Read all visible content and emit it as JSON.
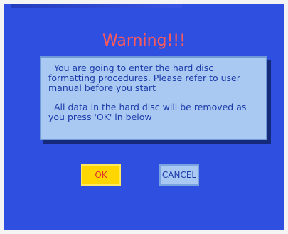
{
  "title": "Warning!!!",
  "message": {
    "line1": "You are going to enter the hard disc formatting procedures. Please refer to user manual before you start",
    "line2": "All data in the hard disc will be removed as you press 'OK' in below"
  },
  "buttons": {
    "ok_label": "OK",
    "cancel_label": "CANCEL"
  },
  "colors": {
    "background": "#2f4fe0",
    "title": "#ff5a5a",
    "dialog": "#a9c8f2",
    "ok_button": "#ffd600"
  }
}
